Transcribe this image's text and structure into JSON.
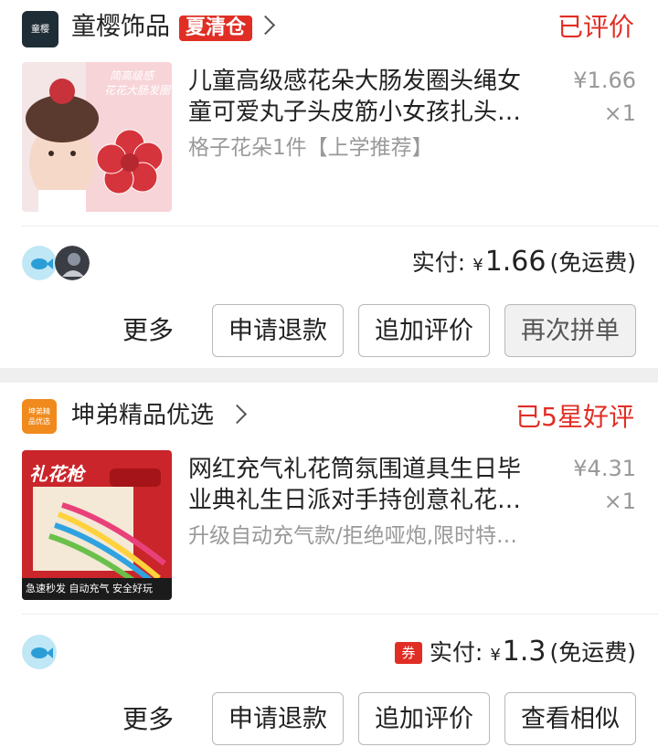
{
  "orders": [
    {
      "shop": {
        "name": "童樱饰品",
        "badge": "夏清仓",
        "logo_text": "童樱"
      },
      "status": "已评价",
      "item": {
        "title_line1": "儿童高级感花朵大肠发圈头绳女",
        "title_line2": "童可爱丸子头皮筋小女孩扎头…",
        "spec": "格子花朵1件【上学推荐】",
        "price": "¥1.66",
        "qty": "×1",
        "thumb_text_1": "简高级感",
        "thumb_text_2": "花花大肠发圈"
      },
      "pay": {
        "label": "实付:",
        "currency": "¥",
        "amount": "1.66",
        "shipping": "(免运费)"
      },
      "actions": {
        "more": "更多",
        "refund": "申请退款",
        "review": "追加评价",
        "third": "再次拼单"
      }
    },
    {
      "shop": {
        "name": "坤弟精品优选",
        "logo_text": "坤弟精品优选"
      },
      "status": "已5星好评",
      "item": {
        "title_line1": "网红充气礼花筒氛围道具生日毕",
        "title_line2": "业典礼生日派对手持创意礼花…",
        "spec": "升级自动充气款/拒绝哑炮,限时特…",
        "price": "¥4.31",
        "qty": "×1",
        "thumb_text_1": "礼花枪",
        "thumb_text_2": "急速秒发 自动充气 安全好玩"
      },
      "pay": {
        "coupon": "券",
        "label": "实付:",
        "currency": "¥",
        "amount": "1.3",
        "shipping": "(免运费)"
      },
      "actions": {
        "more": "更多",
        "refund": "申请退款",
        "review": "追加评价",
        "third": "查看相似"
      }
    }
  ],
  "colors": {
    "accent": "#e02e24",
    "muted": "#999999"
  }
}
